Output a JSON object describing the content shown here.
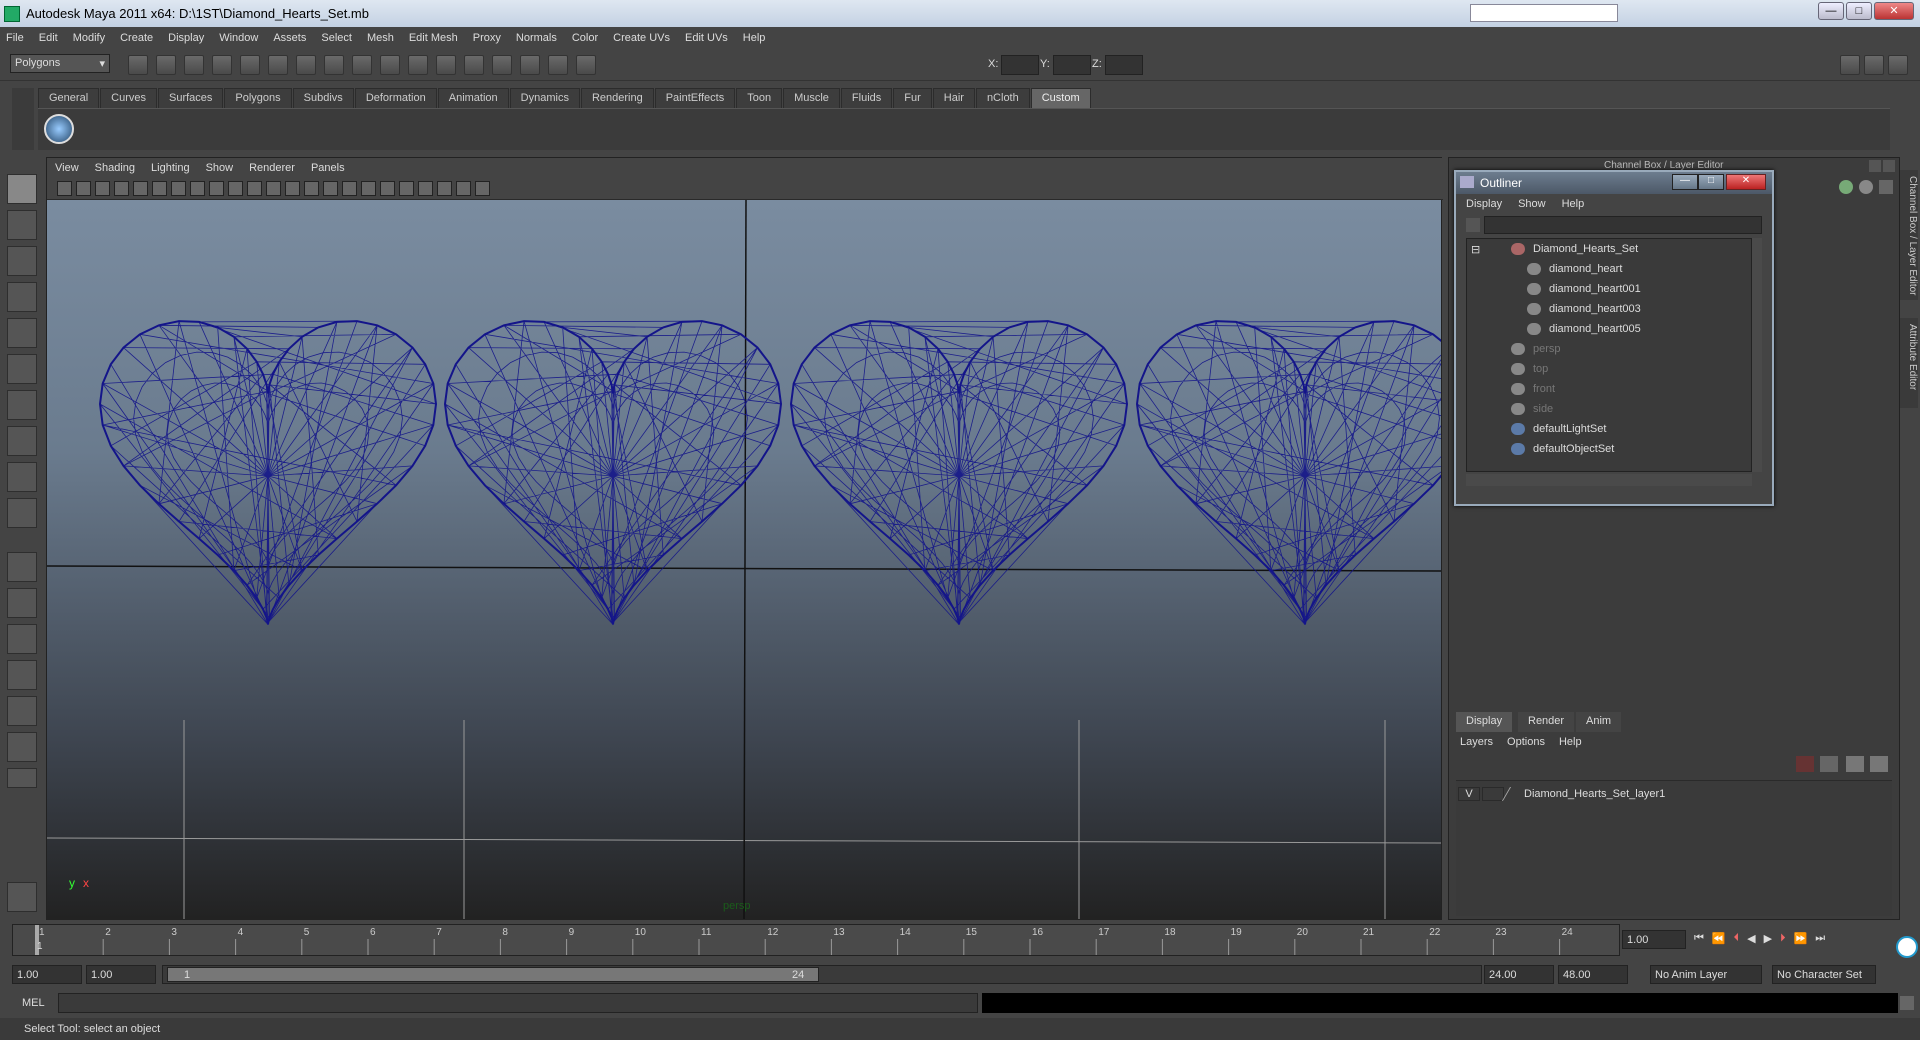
{
  "window": {
    "title": "Autodesk Maya 2011 x64: D:\\1ST\\Diamond_Hearts_Set.mb",
    "minimize": "—",
    "maximize": "□",
    "close": "✕"
  },
  "menubar": [
    "File",
    "Edit",
    "Modify",
    "Create",
    "Display",
    "Window",
    "Assets",
    "Select",
    "Mesh",
    "Edit Mesh",
    "Proxy",
    "Normals",
    "Color",
    "Create UVs",
    "Edit UVs",
    "Help"
  ],
  "statusline": {
    "mode": "Polygons",
    "x_label": "X:",
    "y_label": "Y:",
    "z_label": "Z:"
  },
  "shelf": {
    "tabs": [
      "General",
      "Curves",
      "Surfaces",
      "Polygons",
      "Subdivs",
      "Deformation",
      "Animation",
      "Dynamics",
      "Rendering",
      "PaintEffects",
      "Toon",
      "Muscle",
      "Fluids",
      "Fur",
      "Hair",
      "nCloth",
      "Custom"
    ],
    "active": "Custom"
  },
  "viewport": {
    "menu": [
      "View",
      "Shading",
      "Lighting",
      "Show",
      "Renderer",
      "Panels"
    ],
    "camera_label": "persp",
    "axis_y": "y",
    "axis_x": "x",
    "heart_color": "#14158a"
  },
  "right_panel": {
    "header": "Channel Box / Layer Editor",
    "side_tabs": [
      "Channel Box / Layer Editor",
      "Attribute Editor"
    ]
  },
  "outliner": {
    "title": "Outliner",
    "menu": [
      "Display",
      "Show",
      "Help"
    ],
    "items": [
      {
        "label": "Diamond_Hearts_Set",
        "dim": false
      },
      {
        "label": "diamond_heart",
        "dim": false
      },
      {
        "label": "diamond_heart001",
        "dim": false
      },
      {
        "label": "diamond_heart003",
        "dim": false
      },
      {
        "label": "diamond_heart005",
        "dim": false
      },
      {
        "label": "persp",
        "dim": true
      },
      {
        "label": "top",
        "dim": true
      },
      {
        "label": "front",
        "dim": true
      },
      {
        "label": "side",
        "dim": true
      },
      {
        "label": "defaultLightSet",
        "dim": false
      },
      {
        "label": "defaultObjectSet",
        "dim": false
      }
    ]
  },
  "layer_editor": {
    "tabs": [
      "Display",
      "Render",
      "Anim"
    ],
    "menu": [
      "Layers",
      "Options",
      "Help"
    ],
    "layer_visible": "V",
    "layer_name": "Diamond_Hearts_Set_layer1"
  },
  "time_slider": {
    "ticks": [
      "1",
      "2",
      "3",
      "4",
      "5",
      "6",
      "7",
      "8",
      "9",
      "10",
      "11",
      "12",
      "13",
      "14",
      "15",
      "16",
      "17",
      "18",
      "19",
      "20",
      "21",
      "22",
      "23",
      "24"
    ],
    "current_frame": "1",
    "current_time": "1.00"
  },
  "range": {
    "start_time": "1.00",
    "playback_start": "1.00",
    "range_start": "1",
    "range_end": "24",
    "playback_end": "24.00",
    "end_time": "48.00",
    "anim_layer": "No Anim Layer",
    "character_set": "No Character Set"
  },
  "cmdline": {
    "label": "MEL"
  },
  "helpline": {
    "text": "Select Tool: select an object"
  }
}
